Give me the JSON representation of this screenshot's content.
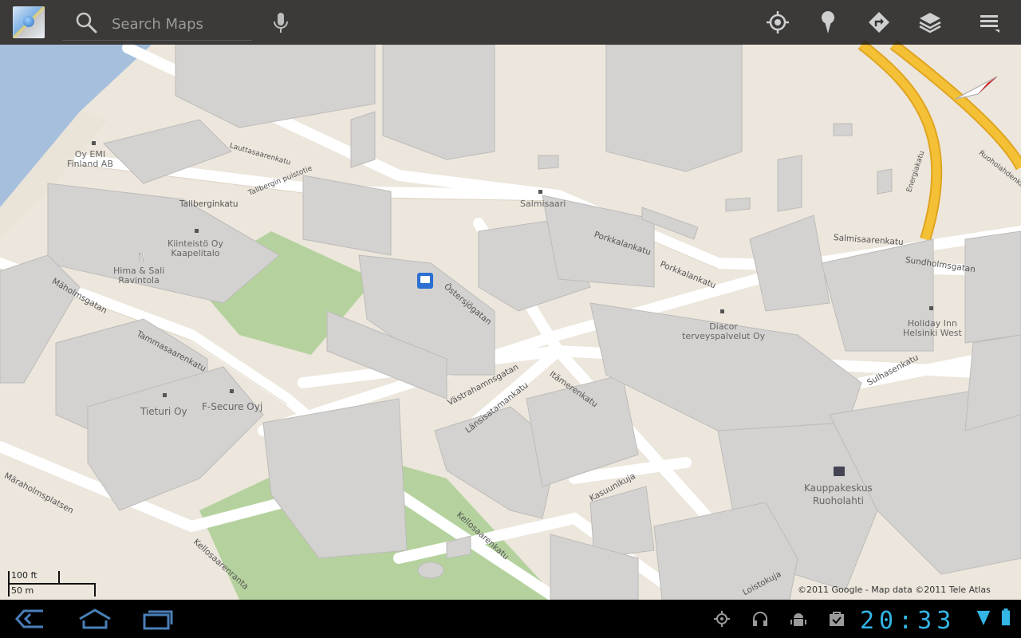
{
  "search": {
    "placeholder": "Search Maps"
  },
  "actionbar": {
    "icons": [
      "app-logo",
      "search-icon",
      "mic-icon",
      "my-location-icon",
      "places-pin-icon",
      "directions-icon",
      "layers-icon",
      "menu-icon"
    ]
  },
  "map": {
    "streets": [
      "Tallberginkatu",
      "Salmisaarenkatu",
      "Porkkalankatu",
      "Östersjögatan",
      "Västrahamnsgatan",
      "Länsisatamankatu",
      "Itämerenkatu",
      "Sulhasenkatu",
      "Sundholmsgatan",
      "Tammasaarenkatu",
      "Mäholmsgatan",
      "Märaholmsplatsen",
      "Kellosaarenkatu",
      "Kellosaarenranta",
      "Kasuunikuja",
      "Loistokuja",
      "Lauttasaarenkatu",
      "Tallbergin puistotie",
      "Energiakatu",
      "Ruoholahdenkatu"
    ],
    "places": {
      "oy_emi": "Oy EMI\nFinland AB",
      "kiinteisto": "Kiinteistö Oy\nKaapelitalo",
      "hima_sali": "Hima & Sali\nRavintola",
      "salmisaari": "Salmisaari",
      "diacor": "Diacor\nterveyspalvelut Oy",
      "holiday_inn": "Holiday Inn\nHelsinki West",
      "tieturi": "Tieturi Oy",
      "fsecure": "F-Secure Oyj",
      "kauppakeskus": "Kauppakeskus\nRuoholahti"
    },
    "scale": {
      "imperial": "100 ft",
      "metric": "50 m"
    },
    "copyright": "©2011 Google - Map data ©2011 Tele Atlas"
  },
  "sysbar": {
    "clock": "20:33",
    "icons": [
      "back-icon",
      "home-icon",
      "recent-apps-icon",
      "gps-icon",
      "headphones-icon",
      "android-debug-icon",
      "task-done-icon",
      "signal-icon",
      "battery-icon"
    ]
  },
  "colors": {
    "map_bg": "#ece6dc",
    "building": "#d4d2d0",
    "park": "#b5d29e",
    "water": "#a5bfdd",
    "highway": "#f4c035",
    "accent": "#33b5e5"
  }
}
